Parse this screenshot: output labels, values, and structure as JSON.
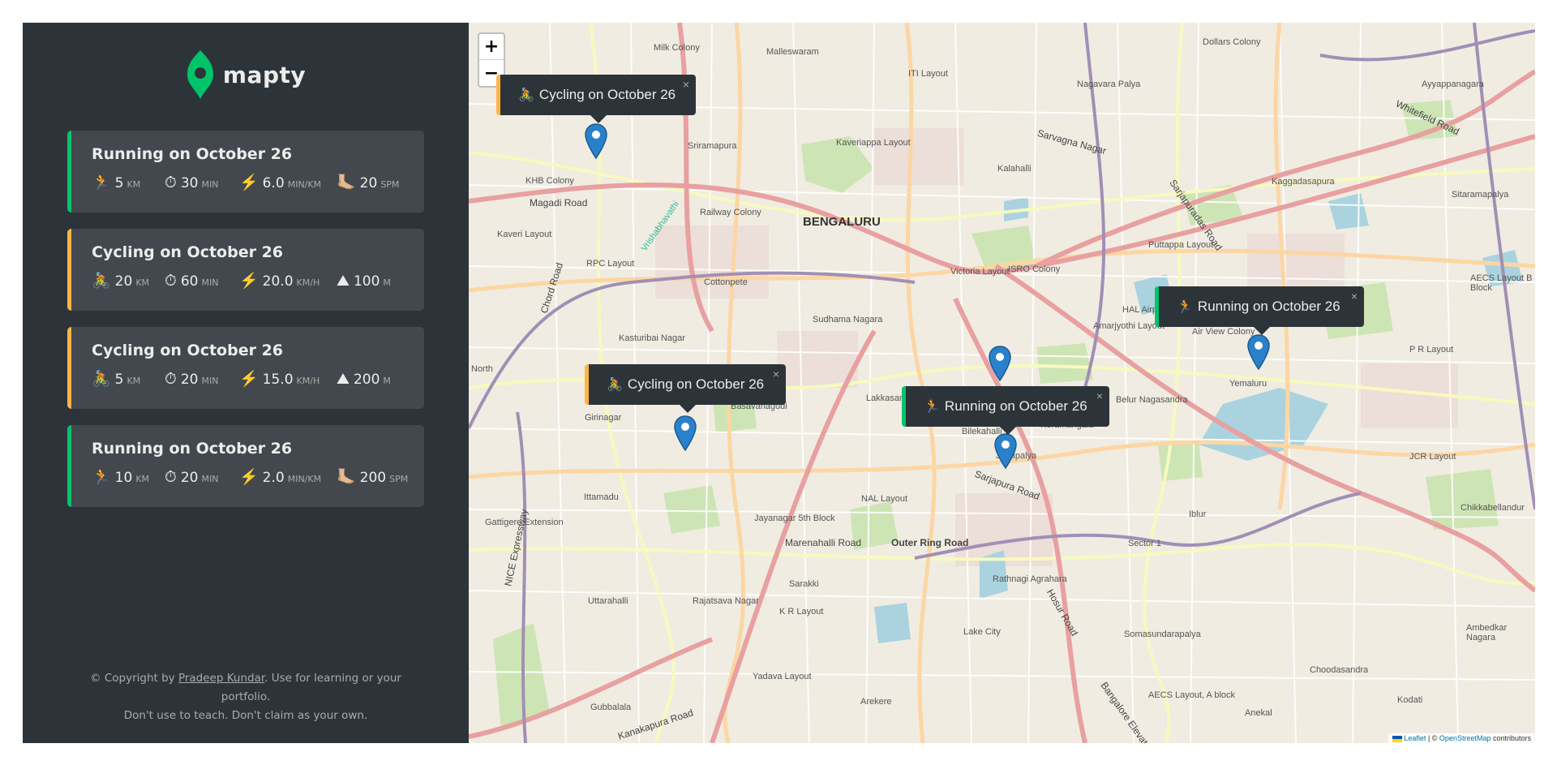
{
  "app": {
    "logo_text": "mapty",
    "brand_color": "#00c46a",
    "running_color": "#00c46a",
    "cycling_color": "#ffb545"
  },
  "workouts": [
    {
      "type": "running",
      "title": "Running on October 26",
      "details": [
        {
          "icon": "🏃",
          "value": "5",
          "unit": "KM"
        },
        {
          "icon": "⏱",
          "value": "30",
          "unit": "MIN"
        },
        {
          "icon": "⚡️",
          "value": "6.0",
          "unit": "MIN/KM"
        },
        {
          "icon": "🦶🏼",
          "value": "20",
          "unit": "SPM"
        }
      ]
    },
    {
      "type": "cycling",
      "title": "Cycling on October 26",
      "details": [
        {
          "icon": "🚴",
          "value": "20",
          "unit": "KM"
        },
        {
          "icon": "⏱",
          "value": "60",
          "unit": "MIN"
        },
        {
          "icon": "⚡️",
          "value": "20.0",
          "unit": "KM/H"
        },
        {
          "icon": "⛰",
          "value": "100",
          "unit": "M"
        }
      ]
    },
    {
      "type": "cycling",
      "title": "Cycling on October 26",
      "details": [
        {
          "icon": "🚴",
          "value": "5",
          "unit": "KM"
        },
        {
          "icon": "⏱",
          "value": "20",
          "unit": "MIN"
        },
        {
          "icon": "⚡️",
          "value": "15.0",
          "unit": "KM/H"
        },
        {
          "icon": "⛰",
          "value": "200",
          "unit": "M"
        }
      ]
    },
    {
      "type": "running",
      "title": "Running on October 26",
      "details": [
        {
          "icon": "🏃",
          "value": "10",
          "unit": "KM"
        },
        {
          "icon": "⏱",
          "value": "20",
          "unit": "MIN"
        },
        {
          "icon": "⚡️",
          "value": "2.0",
          "unit": "MIN/KM"
        },
        {
          "icon": "🦶🏼",
          "value": "200",
          "unit": "SPM"
        }
      ]
    }
  ],
  "footer": {
    "prefix": "© Copyright by ",
    "author": "Pradeep Kundar",
    "suffix": ". Use for learning or your portfolio.",
    "line2": "Don't use to teach. Don't claim as your own."
  },
  "map": {
    "zoom_in": "+",
    "zoom_out": "−",
    "popups": [
      {
        "type": "cycling",
        "icon": "🚴",
        "text": "Cycling on October 26",
        "close": "×"
      },
      {
        "type": "cycling",
        "icon": "🚴",
        "text": "Cycling on October 26",
        "close": "×"
      },
      {
        "type": "running",
        "icon": "🏃",
        "text": "Running on October 26",
        "close": "×"
      },
      {
        "type": "running",
        "icon": "🏃",
        "text": "Running on October 26",
        "close": "×"
      }
    ],
    "labels": {
      "city": "BENGALURU",
      "l1": "Milk Colony",
      "l2": "Malleswaram",
      "l3": "Sriramapura",
      "l4": "KHB Colony",
      "l5": "Magadi Road",
      "l6": "Kaveri Layout",
      "l7": "RPC Layout",
      "l8": "Cottonpete",
      "l9": "Kasturibai Nagar",
      "l10": "Basavanagudi",
      "l11": "Girinagar",
      "l12": "Ittamadu",
      "l13": "Jayanagar 5th Block",
      "l14": "Marenahalli Road",
      "l15": "Outer Ring Road",
      "l16": "Sarakki",
      "l17": "Rajatsava Nagar",
      "l18": "Uttarahalli",
      "l19": "Gubbalala",
      "l20": "Kanakapura Road",
      "l21": "Sudhama Nagara",
      "l22": "Lakkasandra",
      "l23": "NAL Layout",
      "l24": "Sarjapura Road",
      "l25": "Koramangala",
      "l26": "Bilekahalli",
      "l27": "Lake City",
      "l28": "Hosur Road",
      "l29": "Somasundarapalya",
      "l30": "Belur Nagasandra",
      "l31": "Yemaluru",
      "l32": "Air View Colony",
      "l33": "HAL Airport",
      "l34": "ISRO Colony",
      "l35": "Victoria Layout",
      "l36": "Kalahalli",
      "l37": "Sarvagna Nagar",
      "l38": "Kaggadasapura",
      "l39": "Whitefield Road",
      "l40": "Ayyappanagara",
      "l41": "Sitaramapalya",
      "l42": "AECS Layout B Block",
      "l43": "JCR Layout",
      "l44": "Chikkabellandur",
      "l45": "Ambedkar Nagara",
      "l46": "Choodasandra",
      "l47": "Kodati",
      "l48": "Anekal",
      "l49": "AECS Layout, A block",
      "l50": "Bangalore Elevated",
      "l51": "Arekere",
      "l52": "Yadava Layout",
      "l53": "K R Layout",
      "l54": "NICE Expressway",
      "l55": "Gattigere Extension",
      "l56": "North",
      "l57": "Chord Road",
      "l58": "Nagavara Palya",
      "l59": "ITI Layout",
      "l60": "Kaveriappa Layout",
      "l61": "Railway Colony",
      "l62": "Vrishabhavathi",
      "l63": "Puttappa Layout",
      "l64": "Jogupalya",
      "l65": "Sarjapuradas Road",
      "l66": "Amarjyothi Layout",
      "l67": "Dollars Colony",
      "l68": "P R Layout",
      "l69": "Sector 1",
      "l70": "Iblur",
      "l71": "Rathnagi Agrahara"
    },
    "attribution": {
      "leaflet": "Leaflet",
      "sep": " | © ",
      "osm": "OpenStreetMap",
      "suffix": " contributors"
    }
  }
}
